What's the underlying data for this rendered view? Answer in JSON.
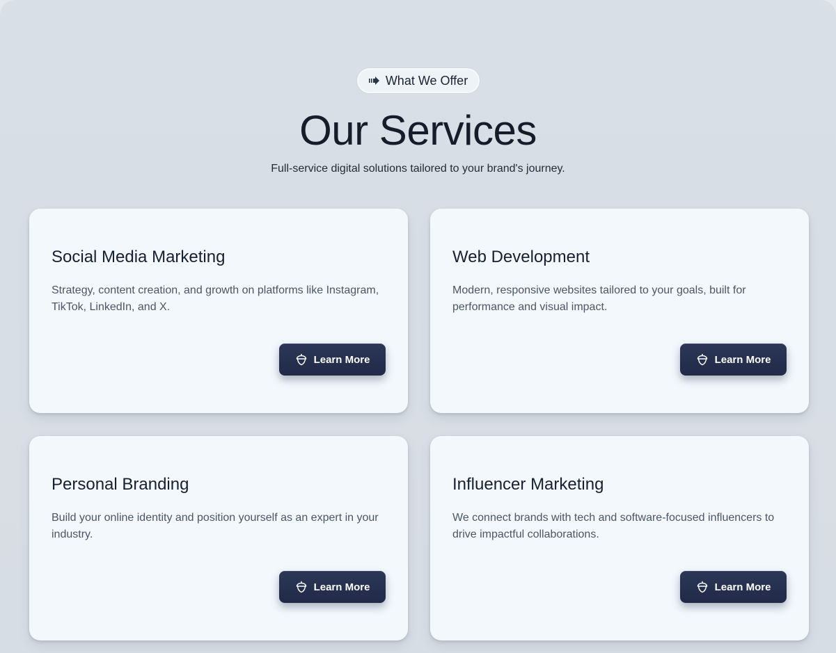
{
  "header": {
    "badge_label": "What We Offer",
    "badge_icon": "arrow-right-icon",
    "title": "Our Services",
    "subtitle": "Full-service digital solutions tailored to your brand's journey."
  },
  "services": [
    {
      "title": "Social Media Marketing",
      "description": "Strategy, content creation, and growth on platforms like Instagram, TikTok, LinkedIn, and X.",
      "button_label": "Learn More",
      "button_icon": "acorn-icon"
    },
    {
      "title": "Web Development",
      "description": "Modern, responsive websites tailored to your goals, built for performance and visual impact.",
      "button_label": "Learn More",
      "button_icon": "acorn-icon"
    },
    {
      "title": "Personal Branding",
      "description": "Build your online identity and position yourself as an expert in your industry.",
      "button_label": "Learn More",
      "button_icon": "acorn-icon"
    },
    {
      "title": "Influencer Marketing",
      "description": "We connect brands with tech and software-focused influencers to drive impactful collaborations.",
      "button_label": "Learn More",
      "button_icon": "acorn-icon"
    }
  ],
  "colors": {
    "background": "#d9dfe6",
    "card": "#f3f8fc",
    "button": "#242e4c",
    "heading": "#151d2a",
    "body_text": "#4b5565"
  }
}
